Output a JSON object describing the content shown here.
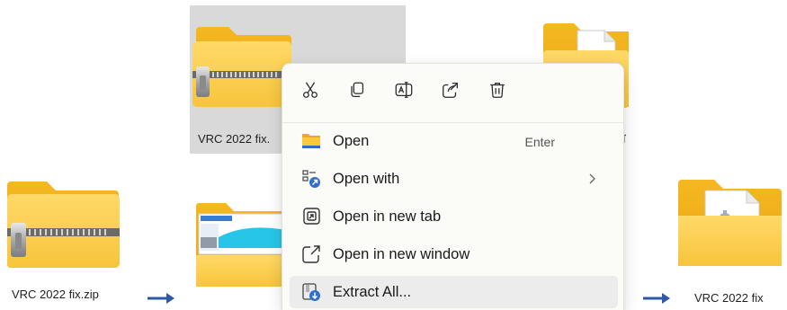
{
  "files": {
    "zip_top_label": "VRC 2022 fix.",
    "zip_bottom_label": "VRC 2022 fix.zip",
    "folder_right_label": "VRC 2022 fix",
    "partial_right_char": "ĩ"
  },
  "context_menu": {
    "quick_actions": [
      {
        "icon": "cut-icon"
      },
      {
        "icon": "copy-icon"
      },
      {
        "icon": "rename-icon"
      },
      {
        "icon": "share-icon"
      },
      {
        "icon": "delete-icon"
      }
    ],
    "items": [
      {
        "label": "Open",
        "shortcut": "Enter",
        "icon": "folder-icon"
      },
      {
        "label": "Open with",
        "icon": "open-with-icon",
        "submenu": true
      },
      {
        "label": "Open in new tab",
        "icon": "new-tab-icon"
      },
      {
        "label": "Open in new window",
        "icon": "new-window-icon"
      },
      {
        "label": "Extract All...",
        "icon": "extract-icon",
        "highlighted": true
      }
    ]
  },
  "colors": {
    "folder_back": "#f2b21f",
    "folder_front": "#fcd15b",
    "accent_blue": "#2e58a6",
    "menu_bg": "#fbfbf8",
    "selection": "#d9d9d9"
  }
}
